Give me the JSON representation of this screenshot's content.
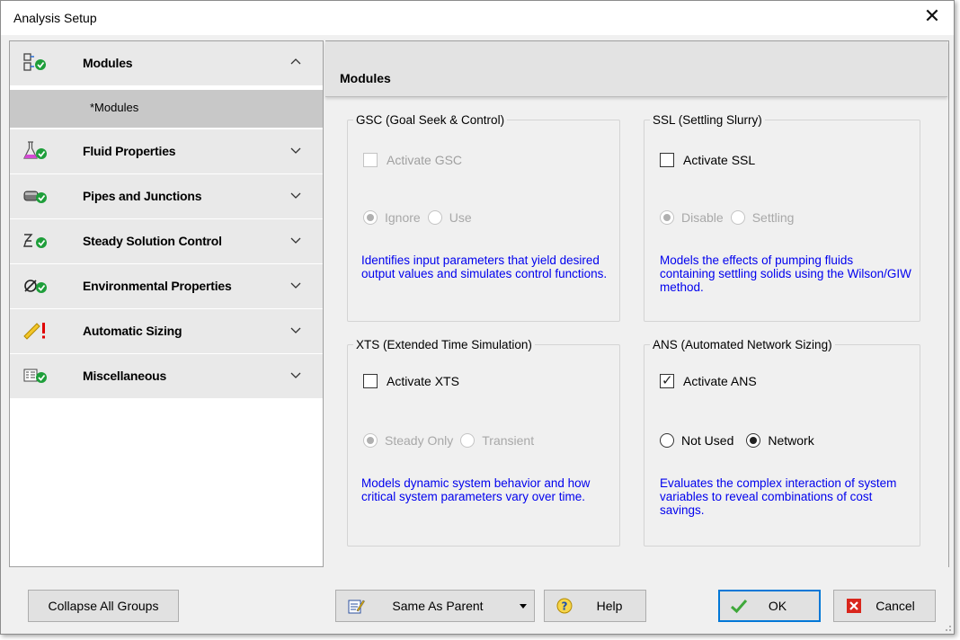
{
  "window": {
    "title": "Analysis Setup"
  },
  "sidebar": {
    "groups": [
      {
        "label": "Modules",
        "icon": "modules-icon",
        "expanded": true,
        "status": "ok"
      },
      {
        "label": "Fluid Properties",
        "icon": "flask-icon",
        "expanded": false,
        "status": "ok"
      },
      {
        "label": "Pipes and Junctions",
        "icon": "pipe-icon",
        "expanded": false,
        "status": "ok"
      },
      {
        "label": "Steady Solution Control",
        "icon": "solution-control-icon",
        "expanded": false,
        "status": "ok"
      },
      {
        "label": "Environmental Properties",
        "icon": "environment-icon",
        "expanded": false,
        "status": "ok"
      },
      {
        "label": "Automatic Sizing",
        "icon": "ruler-icon",
        "expanded": false,
        "status": "warning"
      },
      {
        "label": "Miscellaneous",
        "icon": "misc-list-icon",
        "expanded": false,
        "status": "ok"
      }
    ],
    "subitems": [
      {
        "label": "*Modules",
        "selected": true
      }
    ]
  },
  "main": {
    "header": "Modules",
    "gsc": {
      "legend": "GSC (Goal Seek & Control)",
      "checkbox_label": "Activate GSC",
      "checked": false,
      "enabled": false,
      "options": [
        "Ignore",
        "Use"
      ],
      "selected": "Ignore",
      "description": "Identifies input parameters that yield desired output values and simulates control functions."
    },
    "ssl": {
      "legend": "SSL (Settling Slurry)",
      "checkbox_label": "Activate SSL",
      "checked": false,
      "enabled": true,
      "options": [
        "Disable",
        "Settling"
      ],
      "selected": "Disable",
      "description": "Models the effects of pumping fluids containing settling solids using the Wilson/GIW method."
    },
    "xts": {
      "legend": "XTS (Extended Time Simulation)",
      "checkbox_label": "Activate XTS",
      "checked": false,
      "enabled": true,
      "options": [
        "Steady Only",
        "Transient"
      ],
      "selected": "Steady Only",
      "description": "Models dynamic system behavior and how critical system parameters vary over time."
    },
    "ans": {
      "legend": "ANS (Automated Network Sizing)",
      "checkbox_label": "Activate ANS",
      "checked": true,
      "enabled": true,
      "options": [
        "Not Used",
        "Network"
      ],
      "selected": "Network",
      "description": "Evaluates the complex interaction of system variables to reveal combinations of cost savings."
    }
  },
  "footer": {
    "collapse_label": "Collapse All Groups",
    "same_as_parent_label": "Same As Parent",
    "help_label": "Help",
    "ok_label": "OK",
    "cancel_label": "Cancel"
  },
  "colors": {
    "description_text": "#0000ee",
    "status_ok": "#1e9e3a",
    "status_warning": "#e00000",
    "sidebar_group_bg": "#e9e9e9",
    "sidebar_selected_bg": "#c8c8c8",
    "primary_border": "#0078d7"
  }
}
